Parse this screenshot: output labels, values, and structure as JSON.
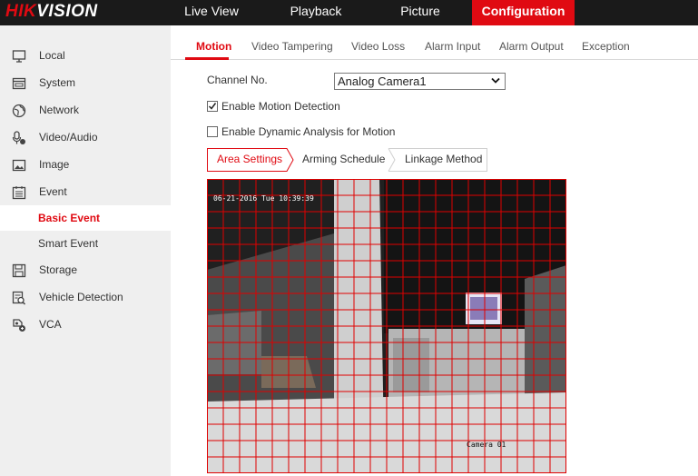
{
  "brand": {
    "part1": "HIK",
    "part2": "VISION"
  },
  "nav": [
    {
      "label": "Live View"
    },
    {
      "label": "Playback"
    },
    {
      "label": "Picture"
    },
    {
      "label": "Configuration"
    }
  ],
  "sidebar": {
    "items": [
      {
        "label": "Local",
        "icon": "monitor-icon"
      },
      {
        "label": "System",
        "icon": "system-icon"
      },
      {
        "label": "Network",
        "icon": "globe-icon"
      },
      {
        "label": "Video/Audio",
        "icon": "microphone-icon"
      },
      {
        "label": "Image",
        "icon": "image-icon"
      },
      {
        "label": "Event",
        "icon": "calendar-icon"
      },
      {
        "label": "Storage",
        "icon": "floppy-icon"
      },
      {
        "label": "Vehicle Detection",
        "icon": "vehicle-search-icon"
      },
      {
        "label": "VCA",
        "icon": "vca-icon"
      }
    ],
    "sub": [
      {
        "label": "Basic Event"
      },
      {
        "label": "Smart Event"
      }
    ]
  },
  "tabs": [
    {
      "label": "Motion"
    },
    {
      "label": "Video Tampering"
    },
    {
      "label": "Video Loss"
    },
    {
      "label": "Alarm Input"
    },
    {
      "label": "Alarm Output"
    },
    {
      "label": "Exception"
    }
  ],
  "form": {
    "channel_label": "Channel No.",
    "channel_value": "Analog Camera1",
    "enable_motion": {
      "label": "Enable Motion Detection",
      "checked": true
    },
    "enable_dynamic": {
      "label": "Enable Dynamic Analysis for Motion",
      "checked": false
    }
  },
  "subtabs": [
    {
      "label": "Area Settings"
    },
    {
      "label": "Arming Schedule"
    },
    {
      "label": "Linkage Method"
    }
  ],
  "video": {
    "timestamp": "06-21-2016 Tue 10:39:39",
    "camera_name": "Camera 01",
    "grid_color": "#e00000",
    "grid_cols": 22,
    "grid_rows": 18
  },
  "colors": {
    "accent": "#e00a12",
    "topbar": "#1a1a1a",
    "sidebar": "#efefef"
  }
}
